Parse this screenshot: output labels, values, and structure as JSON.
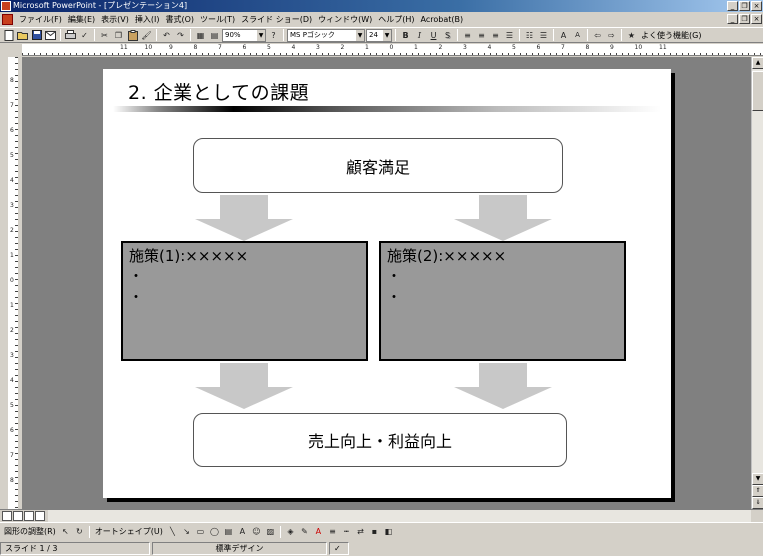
{
  "window": {
    "title": "Microsoft PowerPoint - [プレゼンテーション4]"
  },
  "menu": [
    "ファイル(F)",
    "編集(E)",
    "表示(V)",
    "挿入(I)",
    "書式(O)",
    "ツール(T)",
    "スライド ショー(D)",
    "ウィンドウ(W)",
    "ヘルプ(H)",
    "Acrobat(B)"
  ],
  "toolbar": {
    "zoom": "90%",
    "font": "MS Pゴシック",
    "size": "24",
    "bold": "B",
    "italic": "I",
    "underline": "U",
    "shadow": "S",
    "help_label": "よく使う機能(G)"
  },
  "ruler": {
    "h_labels": [
      "11",
      "10",
      "9",
      "8",
      "7",
      "6",
      "5",
      "4",
      "3",
      "2",
      "1",
      "0",
      "1",
      "2",
      "3",
      "4",
      "5",
      "6",
      "7",
      "8",
      "9",
      "10",
      "11"
    ],
    "v_labels": [
      "8",
      "7",
      "6",
      "5",
      "4",
      "3",
      "2",
      "1",
      "0",
      "1",
      "2",
      "3",
      "4",
      "5",
      "6",
      "7",
      "8"
    ]
  },
  "slide": {
    "title": "2. 企業としての課題",
    "top_box": "顧客満足",
    "left_box": {
      "heading": "施策(1):×××××",
      "bullets": [
        "・",
        "・"
      ]
    },
    "right_box": {
      "heading": "施策(2):×××××",
      "bullets": [
        "・",
        "・"
      ]
    },
    "bottom_box": "売上向上・利益向上"
  },
  "drawing": {
    "draw_label": "図形の調整(R)",
    "autoshape_label": "オートシェイプ(U)"
  },
  "status": {
    "slide": "スライド 1 / 3",
    "design": "標準デザイン"
  },
  "colors": {
    "arrow": "#c8c8c8",
    "box_fill": "#999999",
    "titlebar": "#0a246a"
  }
}
